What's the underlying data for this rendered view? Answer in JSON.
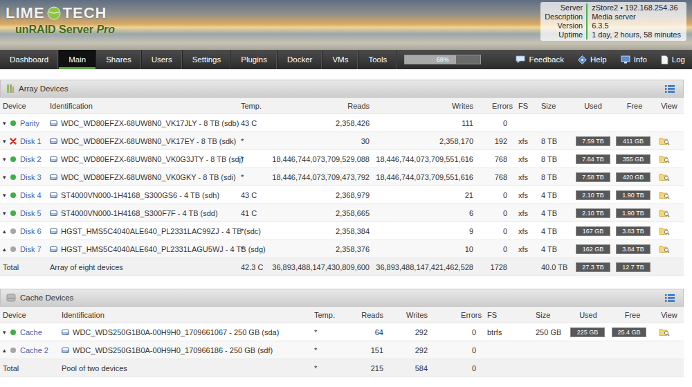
{
  "header": {
    "logo": {
      "left": "LIME",
      "right": "TECH",
      "product": "unRAID Server",
      "edition": "Pro"
    },
    "info": [
      {
        "label": "Server",
        "value": "zStore2 • 192.168.254.36"
      },
      {
        "label": "Description",
        "value": "Media server"
      },
      {
        "label": "Version",
        "value": "6.3.5"
      },
      {
        "label": "Uptime",
        "value": "1 day, 2 hours, 58 minutes"
      }
    ]
  },
  "nav": {
    "tabs": [
      {
        "label": "Dashboard",
        "selected": false
      },
      {
        "label": "Main",
        "selected": true
      },
      {
        "label": "Shares",
        "selected": false
      },
      {
        "label": "Users",
        "selected": false
      },
      {
        "label": "Settings",
        "selected": false
      },
      {
        "label": "Plugins",
        "selected": false
      },
      {
        "label": "Docker",
        "selected": false
      },
      {
        "label": "VMs",
        "selected": false
      },
      {
        "label": "Tools",
        "selected": false
      }
    ],
    "progress": {
      "level": 0.68,
      "reading": "68%"
    },
    "actions": [
      {
        "label": "Feedback",
        "kind": "feedback"
      },
      {
        "label": "Help",
        "kind": "help"
      },
      {
        "label": "Info",
        "kind": "info"
      },
      {
        "label": "Log",
        "kind": "log"
      }
    ]
  },
  "sections": [
    {
      "title": "Array Devices",
      "kind": "array",
      "columns": [
        "Device",
        "Identification",
        "Temp.",
        "Reads",
        "Writes",
        "Errors",
        "FS",
        "Size",
        "Used",
        "Free",
        "View"
      ],
      "rows": [
        {
          "arrow": "▾",
          "kind": "dot",
          "color": "#3cb043",
          "device": "Parity",
          "identification": "WDC_WD80EFZX-68UW8N0_VK17JLY - 8 TB (sdb)",
          "temp": "43 C",
          "reads": "2,358,426",
          "writes": "111",
          "errors": "0",
          "fs": "",
          "size": "",
          "used": "",
          "free": "",
          "view": false
        },
        {
          "arrow": "▾",
          "kind": "cross",
          "color": "#d9261c",
          "device": "Disk 1",
          "identification": "WDC_WD80EFZX-68UW8N0_VK17EY - 8 TB (sdk)",
          "temp": "*",
          "reads": "30",
          "writes": "2,358,170",
          "errors": "192",
          "fs": "xfs",
          "size": "8 TB",
          "used": "7.59 TB",
          "free": "411 GB",
          "view": true
        },
        {
          "arrow": "▾",
          "kind": "dot",
          "color": "#3cb043",
          "device": "Disk 2",
          "identification": "WDC_WD80EFZX-68UW8N0_VK0G3JTY - 8 TB (sdj)",
          "temp": "*",
          "reads": "18,446,744,073,709,529,088",
          "writes": "18,446,744,073,709,551,616",
          "errors": "768",
          "fs": "xfs",
          "size": "8 TB",
          "used": "7.64 TB",
          "free": "355 GB",
          "view": true
        },
        {
          "arrow": "▾",
          "kind": "dot",
          "color": "#3cb043",
          "device": "Disk 3",
          "identification": "WDC_WD80EFZX-68UW8N0_VK0GKY - 8 TB (sdi)",
          "temp": "*",
          "reads": "18,446,744,073,709,473,792",
          "writes": "18,446,744,073,709,551,616",
          "errors": "768",
          "fs": "xfs",
          "size": "8 TB",
          "used": "7.58 TB",
          "free": "420 GB",
          "view": true
        },
        {
          "arrow": "▾",
          "kind": "dot",
          "color": "#3cb043",
          "device": "Disk 4",
          "identification": "ST4000VN000-1H4168_S300GS6 - 4 TB (sdh)",
          "temp": "43 C",
          "reads": "2,368,979",
          "writes": "21",
          "errors": "0",
          "fs": "xfs",
          "size": "4 TB",
          "used": "2.10 TB",
          "free": "1.90 TB",
          "view": true
        },
        {
          "arrow": "▾",
          "kind": "dot",
          "color": "#3cb043",
          "device": "Disk 5",
          "identification": "ST4000VN000-1H4168_S300F7F - 4 TB (sdd)",
          "temp": "41 C",
          "reads": "2,358,665",
          "writes": "6",
          "errors": "0",
          "fs": "xfs",
          "size": "4 TB",
          "used": "2.10 TB",
          "free": "1.90 TB",
          "view": true
        },
        {
          "arrow": "▴",
          "kind": "dot",
          "color": "#a6a6a6",
          "device": "Disk 6",
          "identification": "HGST_HMS5C4040ALE640_PL2331LAC99ZJ - 4 TB (sdc)",
          "temp": "*",
          "reads": "2,358,384",
          "writes": "9",
          "errors": "0",
          "fs": "xfs",
          "size": "4 TB",
          "used": "167 GB",
          "free": "3.83 TB",
          "view": true
        },
        {
          "arrow": "▴",
          "kind": "dot",
          "color": "#a6a6a6",
          "device": "Disk 7",
          "identification": "HGST_HMS5C4040ALE640_PL2331LAGU5WJ - 4 TB (sdg)",
          "temp": "*",
          "reads": "2,358,376",
          "writes": "10",
          "errors": "0",
          "fs": "xfs",
          "size": "4 TB",
          "used": "162 GB",
          "free": "3.84 TB",
          "view": true
        }
      ],
      "total": {
        "device": "Total",
        "identification": "Array of eight devices",
        "temp": "42.3 C",
        "reads": "36,893,488,147,430,809,600",
        "writes": "36,893,488,147,421,462,528",
        "errors": "1728",
        "fs": "",
        "size": "40.0 TB",
        "used": "27.3 TB",
        "free": "12.7 TB"
      }
    },
    {
      "title": "Cache Devices",
      "kind": "cache",
      "columns": [
        "Device",
        "Identification",
        "Temp.",
        "Reads",
        "Writes",
        "Errors",
        "FS",
        "Size",
        "Used",
        "Free",
        "View"
      ],
      "rows": [
        {
          "arrow": "▾",
          "kind": "dot",
          "color": "#3cb043",
          "device": "Cache",
          "identification": "WDC_WDS250G1B0A-00H9H0_1709661067 - 250 GB (sda)",
          "temp": "*",
          "reads": "64",
          "writes": "292",
          "errors": "0",
          "fs": "btrfs",
          "size": "250 GB",
          "used": "225 GB",
          "free": "25.4 GB",
          "view": true
        },
        {
          "arrow": "▴",
          "kind": "dot",
          "color": "#a6a6a6",
          "device": "Cache 2",
          "identification": "WDC_WDS250G1B0A-00H9H0_170966186 - 250 GB (sdf)",
          "temp": "*",
          "reads": "151",
          "writes": "292",
          "errors": "0",
          "fs": "",
          "size": "",
          "used": "",
          "free": "",
          "view": false
        }
      ],
      "total": {
        "device": "Total",
        "identification": "Pool of two devices",
        "temp": "*",
        "reads": "215",
        "writes": "584",
        "errors": "0",
        "fs": "",
        "size": "",
        "used": "",
        "free": ""
      }
    }
  ]
}
